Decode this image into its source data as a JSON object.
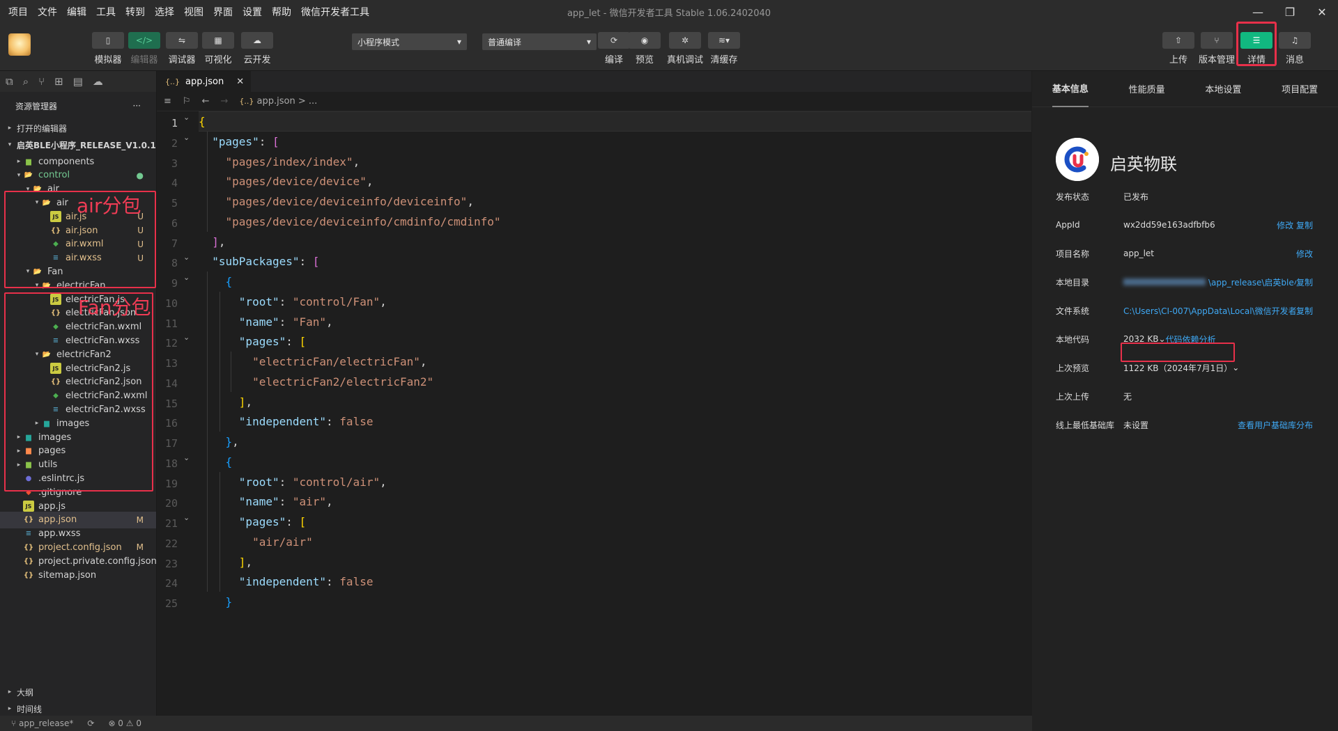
{
  "menu": {
    "items": [
      "项目",
      "文件",
      "编辑",
      "工具",
      "转到",
      "选择",
      "视图",
      "界面",
      "设置",
      "帮助",
      "微信开发者工具"
    ],
    "title": "app_let - 微信开发者工具 Stable 1.06.2402040"
  },
  "toolbar": {
    "simulator": "模拟器",
    "editor": "编辑器",
    "debugger": "调试器",
    "visual": "可视化",
    "cloud": "云开发",
    "mode": "小程序模式",
    "compile_mode": "普通编译",
    "compile": "编译",
    "preview": "预览",
    "real_debug": "真机调试",
    "clear_cache": "清缓存",
    "upload": "上传",
    "version": "版本管理",
    "details": "详情",
    "messages": "消息"
  },
  "sidebar": {
    "title": "资源管理器",
    "more": "···",
    "open_editors": "打开的编辑器",
    "project": "启英BLE小程序_RELEASE_V1.0.1",
    "outline": "大纲",
    "timeline": "时间线",
    "tree": [
      {
        "label": "components",
        "depth": 1,
        "twisty": "▸",
        "icon": "folder-green",
        "badge": ""
      },
      {
        "label": "control",
        "depth": 1,
        "twisty": "▾",
        "icon": "folder-open",
        "badge": "●"
      },
      {
        "label": "air",
        "depth": 2,
        "twisty": "▾",
        "icon": "folder-open",
        "badge": ""
      },
      {
        "label": "air",
        "depth": 3,
        "twisty": "▾",
        "icon": "folder-open",
        "badge": ""
      },
      {
        "label": "air.js",
        "depth": 4,
        "twisty": "",
        "icon": "js",
        "badge": "U"
      },
      {
        "label": "air.json",
        "depth": 4,
        "twisty": "",
        "icon": "json",
        "badge": "U"
      },
      {
        "label": "air.wxml",
        "depth": 4,
        "twisty": "",
        "icon": "wxml",
        "badge": "U"
      },
      {
        "label": "air.wxss",
        "depth": 4,
        "twisty": "",
        "icon": "wxss",
        "badge": "U"
      },
      {
        "label": "Fan",
        "depth": 2,
        "twisty": "▾",
        "icon": "folder-open",
        "badge": ""
      },
      {
        "label": "electricFan",
        "depth": 3,
        "twisty": "▾",
        "icon": "folder-open",
        "badge": ""
      },
      {
        "label": "electricFan.js",
        "depth": 4,
        "twisty": "",
        "icon": "js",
        "badge": ""
      },
      {
        "label": "electricFan.json",
        "depth": 4,
        "twisty": "",
        "icon": "json",
        "badge": ""
      },
      {
        "label": "electricFan.wxml",
        "depth": 4,
        "twisty": "",
        "icon": "wxml",
        "badge": ""
      },
      {
        "label": "electricFan.wxss",
        "depth": 4,
        "twisty": "",
        "icon": "wxss",
        "badge": ""
      },
      {
        "label": "electricFan2",
        "depth": 3,
        "twisty": "▾",
        "icon": "folder-open",
        "badge": ""
      },
      {
        "label": "electricFan2.js",
        "depth": 4,
        "twisty": "",
        "icon": "js",
        "badge": ""
      },
      {
        "label": "electricFan2.json",
        "depth": 4,
        "twisty": "",
        "icon": "json",
        "badge": ""
      },
      {
        "label": "electricFan2.wxml",
        "depth": 4,
        "twisty": "",
        "icon": "wxml",
        "badge": ""
      },
      {
        "label": "electricFan2.wxss",
        "depth": 4,
        "twisty": "",
        "icon": "wxss",
        "badge": ""
      },
      {
        "label": "images",
        "depth": 3,
        "twisty": "▸",
        "icon": "folder-teal",
        "badge": ""
      },
      {
        "label": "images",
        "depth": 1,
        "twisty": "▸",
        "icon": "folder-teal",
        "badge": ""
      },
      {
        "label": "pages",
        "depth": 1,
        "twisty": "▸",
        "icon": "folder-orange",
        "badge": ""
      },
      {
        "label": "utils",
        "depth": 1,
        "twisty": "▸",
        "icon": "folder-green",
        "badge": ""
      },
      {
        "label": ".eslintrc.js",
        "depth": 1,
        "twisty": "",
        "icon": "eslint",
        "badge": ""
      },
      {
        "label": ".gitignore",
        "depth": 1,
        "twisty": "",
        "icon": "git",
        "badge": ""
      },
      {
        "label": "app.js",
        "depth": 1,
        "twisty": "",
        "icon": "js",
        "badge": ""
      },
      {
        "label": "app.json",
        "depth": 1,
        "twisty": "",
        "icon": "json",
        "badge": "M",
        "selected": true
      },
      {
        "label": "app.wxss",
        "depth": 1,
        "twisty": "",
        "icon": "wxss",
        "badge": ""
      },
      {
        "label": "project.config.json",
        "depth": 1,
        "twisty": "",
        "icon": "json",
        "badge": "M"
      },
      {
        "label": "project.private.config.json",
        "depth": 1,
        "twisty": "",
        "icon": "json",
        "badge": ""
      },
      {
        "label": "sitemap.json",
        "depth": 1,
        "twisty": "",
        "icon": "json",
        "badge": ""
      }
    ]
  },
  "annotations": {
    "air": "air分包",
    "fan": "Fan分包"
  },
  "editor": {
    "tab": "app.json",
    "breadcrumb_file": "app.json",
    "breadcrumb_rest": " > ...",
    "lines": [
      [
        [
          "{",
          "b1"
        ]
      ],
      [
        [
          "  ",
          ""
        ],
        [
          "\"pages\"",
          "k"
        ],
        [
          ": ",
          "p"
        ],
        [
          "[",
          "b2"
        ]
      ],
      [
        [
          "    ",
          ""
        ],
        [
          "\"pages/index/index\"",
          "s"
        ],
        [
          ",",
          "p"
        ]
      ],
      [
        [
          "    ",
          ""
        ],
        [
          "\"pages/device/device\"",
          "s"
        ],
        [
          ",",
          "p"
        ]
      ],
      [
        [
          "    ",
          ""
        ],
        [
          "\"pages/device/deviceinfo/deviceinfo\"",
          "s"
        ],
        [
          ",",
          "p"
        ]
      ],
      [
        [
          "    ",
          ""
        ],
        [
          "\"pages/device/deviceinfo/cmdinfo/cmdinfo\"",
          "s"
        ]
      ],
      [
        [
          "  ",
          ""
        ],
        [
          "]",
          "b2"
        ],
        [
          ",",
          "p"
        ]
      ],
      [
        [
          "  ",
          ""
        ],
        [
          "\"subPackages\"",
          "k"
        ],
        [
          ": ",
          "p"
        ],
        [
          "[",
          "b2"
        ]
      ],
      [
        [
          "    ",
          ""
        ],
        [
          "{",
          "b3"
        ]
      ],
      [
        [
          "      ",
          ""
        ],
        [
          "\"root\"",
          "k"
        ],
        [
          ": ",
          "p"
        ],
        [
          "\"control/Fan\"",
          "s"
        ],
        [
          ",",
          "p"
        ]
      ],
      [
        [
          "      ",
          ""
        ],
        [
          "\"name\"",
          "k"
        ],
        [
          ": ",
          "p"
        ],
        [
          "\"Fan\"",
          "s"
        ],
        [
          ",",
          "p"
        ]
      ],
      [
        [
          "      ",
          ""
        ],
        [
          "\"pages\"",
          "k"
        ],
        [
          ": ",
          "p"
        ],
        [
          "[",
          "b1"
        ]
      ],
      [
        [
          "        ",
          ""
        ],
        [
          "\"electricFan/electricFan\"",
          "s"
        ],
        [
          ",",
          "p"
        ]
      ],
      [
        [
          "        ",
          ""
        ],
        [
          "\"electricFan2/electricFan2\"",
          "s"
        ]
      ],
      [
        [
          "      ",
          ""
        ],
        [
          "]",
          "b1"
        ],
        [
          ",",
          "p"
        ]
      ],
      [
        [
          "      ",
          ""
        ],
        [
          "\"independent\"",
          "k"
        ],
        [
          ": ",
          "p"
        ],
        [
          "false",
          "kw"
        ]
      ],
      [
        [
          "    ",
          ""
        ],
        [
          "}",
          "b3"
        ],
        [
          ",",
          "p"
        ]
      ],
      [
        [
          "    ",
          ""
        ],
        [
          "{",
          "b3"
        ]
      ],
      [
        [
          "      ",
          ""
        ],
        [
          "\"root\"",
          "k"
        ],
        [
          ": ",
          "p"
        ],
        [
          "\"control/air\"",
          "s"
        ],
        [
          ",",
          "p"
        ]
      ],
      [
        [
          "      ",
          ""
        ],
        [
          "\"name\"",
          "k"
        ],
        [
          ": ",
          "p"
        ],
        [
          "\"air\"",
          "s"
        ],
        [
          ",",
          "p"
        ]
      ],
      [
        [
          "      ",
          ""
        ],
        [
          "\"pages\"",
          "k"
        ],
        [
          ": ",
          "p"
        ],
        [
          "[",
          "b1"
        ]
      ],
      [
        [
          "        ",
          ""
        ],
        [
          "\"air/air\"",
          "s"
        ]
      ],
      [
        [
          "      ",
          ""
        ],
        [
          "]",
          "b1"
        ],
        [
          ",",
          "p"
        ]
      ],
      [
        [
          "      ",
          ""
        ],
        [
          "\"independent\"",
          "k"
        ],
        [
          ": ",
          "p"
        ],
        [
          "false",
          "kw"
        ]
      ],
      [
        [
          "    ",
          ""
        ],
        [
          "}",
          "b3"
        ]
      ]
    ]
  },
  "details": {
    "tabs": [
      "基本信息",
      "性能质量",
      "本地设置",
      "项目配置"
    ],
    "brand": "启英物联",
    "rows": [
      {
        "key": "发布状态",
        "value": "已发布",
        "action": "",
        "link": false
      },
      {
        "key": "AppId",
        "value": "wx2dd59e163adfbfb6",
        "action": "修改 复制",
        "link": false
      },
      {
        "key": "项目名称",
        "value": "app_let",
        "action": "修改",
        "link": false
      },
      {
        "key": "本地目录",
        "value": "\\app_release\\启英ble小...",
        "action": "复制",
        "link": true
      },
      {
        "key": "文件系统",
        "value": "C:\\Users\\CI-007\\AppData\\Local\\微信开发者...",
        "action": "复制",
        "link": true
      },
      {
        "key": "本地代码",
        "value": "2032 KB",
        "action": "代码依赖分析",
        "link": false
      },
      {
        "key": "上次预览",
        "value": "1122 KB（2024年7月1日）",
        "action": "",
        "link": false
      },
      {
        "key": "上次上传",
        "value": "无",
        "action": "",
        "link": false
      },
      {
        "key": "线上最低基础库",
        "value": "未设置",
        "action": "查看用户基础库分布",
        "link": false
      }
    ]
  },
  "status": {
    "branch": "app_release*",
    "problems": "⊗ 0 ⚠ 0"
  }
}
